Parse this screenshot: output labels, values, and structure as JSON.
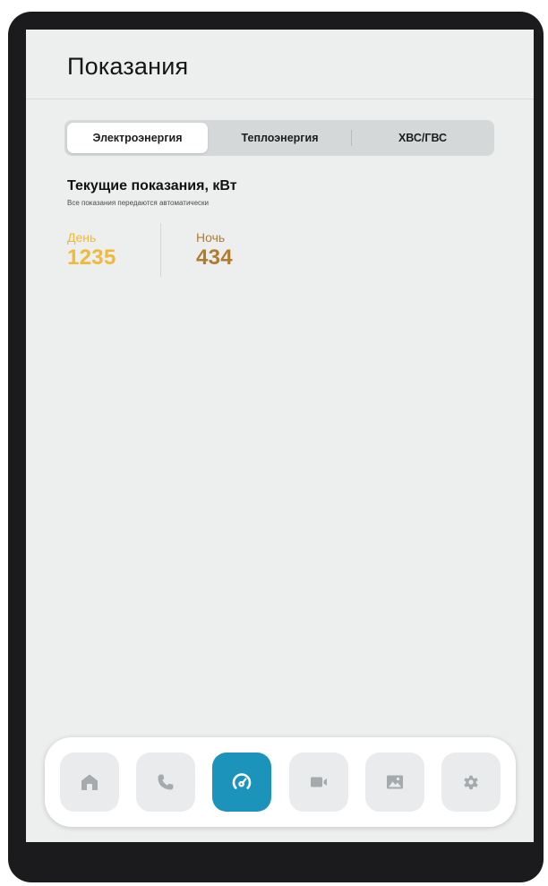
{
  "header": {
    "title": "Показания"
  },
  "tabs": [
    {
      "label": "Электроэнергия",
      "active": true
    },
    {
      "label": "Теплоэнергия",
      "active": false
    },
    {
      "label": "ХВС/ГВС",
      "active": false
    }
  ],
  "readings": {
    "title": "Текущие показания, кВт",
    "subtitle": "Все показания передаются автоматически",
    "day": {
      "label": "День",
      "value": "1235",
      "color": "#f1b937"
    },
    "night": {
      "label": "Ночь",
      "value": "434",
      "color": "#b27c2f"
    }
  },
  "nav": {
    "items": [
      {
        "icon": "home-icon",
        "active": false
      },
      {
        "icon": "phone-icon",
        "active": false
      },
      {
        "icon": "meter-gauge-icon",
        "active": true
      },
      {
        "icon": "video-camera-icon",
        "active": false
      },
      {
        "icon": "gallery-image-icon",
        "active": false
      },
      {
        "icon": "settings-gear-icon",
        "active": false
      }
    ],
    "accent": "#1c93bb",
    "icon_color": "#a5aaac"
  }
}
